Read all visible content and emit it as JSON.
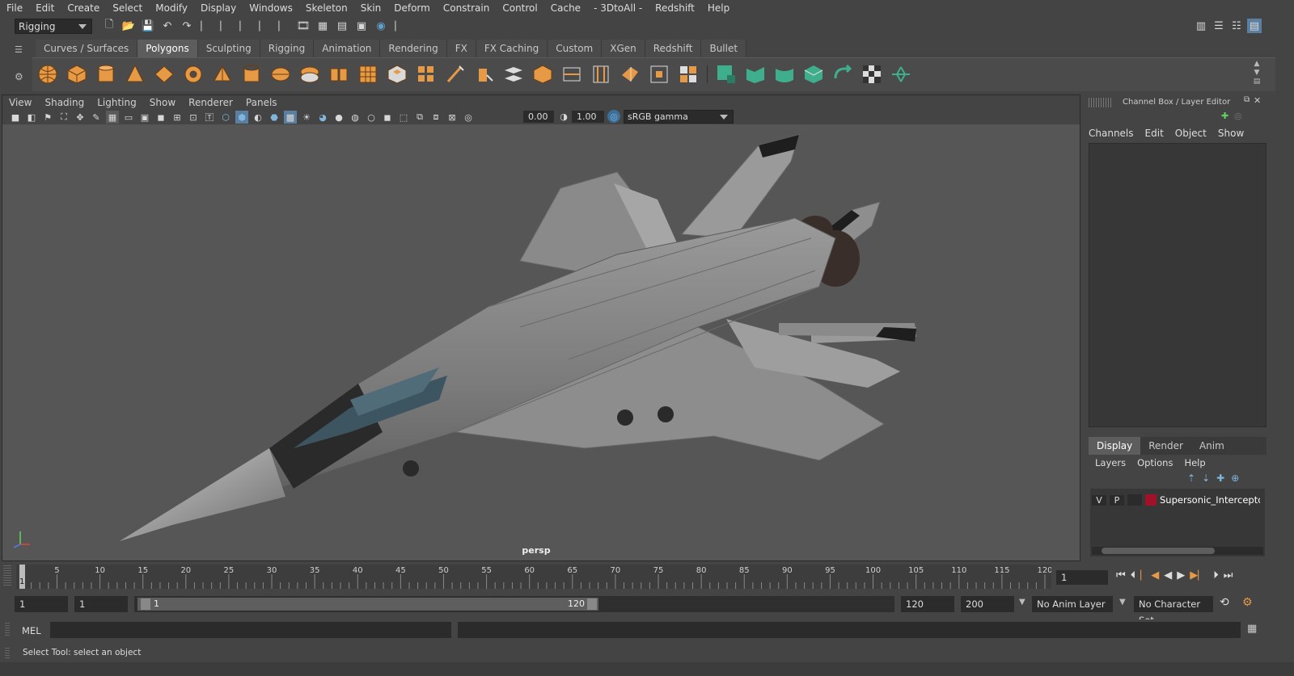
{
  "menu": [
    "File",
    "Edit",
    "Create",
    "Select",
    "Modify",
    "Display",
    "Windows",
    "Skeleton",
    "Skin",
    "Deform",
    "Constrain",
    "Control",
    "Cache",
    "- 3DtoAll -",
    "Redshift",
    "Help"
  ],
  "status": {
    "mode": "Rigging"
  },
  "shelf": {
    "tabs": [
      "Curves / Surfaces",
      "Polygons",
      "Sculpting",
      "Rigging",
      "Animation",
      "Rendering",
      "FX",
      "FX Caching",
      "Custom",
      "XGen",
      "Redshift",
      "Bullet"
    ],
    "active_tab": "Polygons"
  },
  "viewport": {
    "menu": [
      "View",
      "Shading",
      "Lighting",
      "Show",
      "Renderer",
      "Panels"
    ],
    "exposure": "0.00",
    "gamma": "1.00",
    "color_space": "sRGB gamma",
    "camera_label": "persp"
  },
  "channel_box": {
    "title": "Channel Box / Layer Editor",
    "menu": [
      "Channels",
      "Edit",
      "Object",
      "Show"
    ]
  },
  "layer_editor": {
    "tabs": [
      "Display",
      "Render",
      "Anim"
    ],
    "active_tab": "Display",
    "menu": [
      "Layers",
      "Options",
      "Help"
    ],
    "layer": {
      "v": "V",
      "p": "P",
      "name": "Supersonic_Interceptor_",
      "color": "#a0112a"
    }
  },
  "timeline": {
    "ticks": [
      "1",
      "5",
      "10",
      "15",
      "20",
      "25",
      "30",
      "35",
      "40",
      "45",
      "50",
      "55",
      "60",
      "65",
      "70",
      "75",
      "80",
      "85",
      "90",
      "95",
      "100",
      "105",
      "110",
      "115",
      "120"
    ],
    "current_frame": "1"
  },
  "range": {
    "start": "1",
    "playback_start": "1",
    "slider_min": "1",
    "slider_max": "120",
    "playback_end": "120",
    "end": "200",
    "anim_layer": "No Anim Layer",
    "character_set": "No Character Set"
  },
  "command": {
    "label": "MEL"
  },
  "help_line": "Select Tool: select an object",
  "colors": {
    "shelf_orange": "#e79a45",
    "shelf_green": "#3fae8d",
    "accent_blue": "#5fa0c8"
  }
}
